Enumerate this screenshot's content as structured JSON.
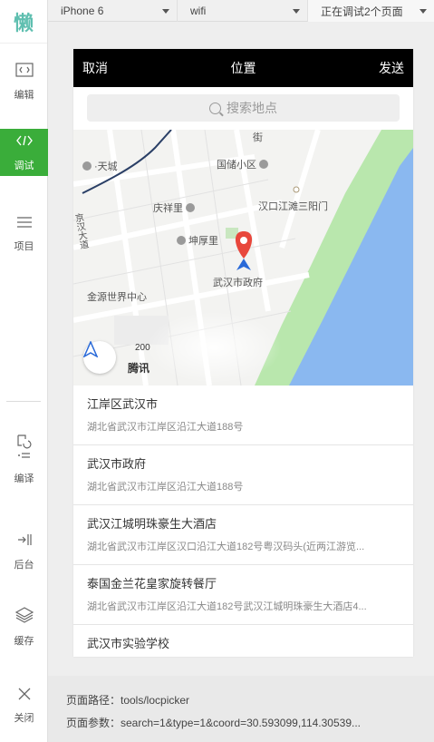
{
  "sidebar": {
    "logo": "懒",
    "items": [
      {
        "label": "编辑",
        "icon": "code-window-icon"
      },
      {
        "label": "调试",
        "icon": "code-brackets-icon"
      },
      {
        "label": "项目",
        "icon": "list-lines-icon"
      },
      {
        "label": "编译",
        "icon": "compile-icon"
      },
      {
        "label": "后台",
        "icon": "background-icon"
      },
      {
        "label": "缓存",
        "icon": "layers-icon"
      },
      {
        "label": "关闭",
        "icon": "close-icon"
      }
    ]
  },
  "toolbar": {
    "device": "iPhone 6",
    "network": "wifi",
    "debug": "正在调试2个页面"
  },
  "phone": {
    "nav": {
      "cancel": "取消",
      "title": "位置",
      "send": "发送"
    },
    "search": {
      "placeholder": "搜索地点"
    },
    "map": {
      "labels": {
        "street": "街",
        "tiancheng": "·天城",
        "guochu": "国储小区",
        "hankou": "汉口江滩三阳门",
        "qingxiang": "庆祥里",
        "kunhou": "坤厚里",
        "gov": "武汉市政府",
        "jinyuan": "金源世界中心",
        "road": "京汉大道",
        "scale": "200",
        "brand": "腾讯"
      },
      "colors": {
        "water": "#8ab8f0",
        "park": "#b9e7ad",
        "road": "#ffffff",
        "marker": "#e8473c",
        "locate": "#2a6ad8"
      }
    },
    "results": [
      {
        "name": "江岸区武汉市",
        "addr": "湖北省武汉市江岸区沿江大道188号"
      },
      {
        "name": "武汉市政府",
        "addr": "湖北省武汉市江岸区沿江大道188号"
      },
      {
        "name": "武汉江城明珠豪生大酒店",
        "addr": "湖北省武汉市江岸区汉口沿江大道182号粤汉码头(近两江游览..."
      },
      {
        "name": "泰国金兰花皇家旋转餐厅",
        "addr": "湖北省武汉市江岸区沿江大道182号武汉江城明珠豪生大酒店4..."
      },
      {
        "name": "武汉市实验学校",
        "addr": ""
      }
    ]
  },
  "pageinfo": {
    "path": "页面路径：tools/locpicker",
    "params": "页面参数：search=1&type=1&coord=30.593099,114.30539..."
  }
}
